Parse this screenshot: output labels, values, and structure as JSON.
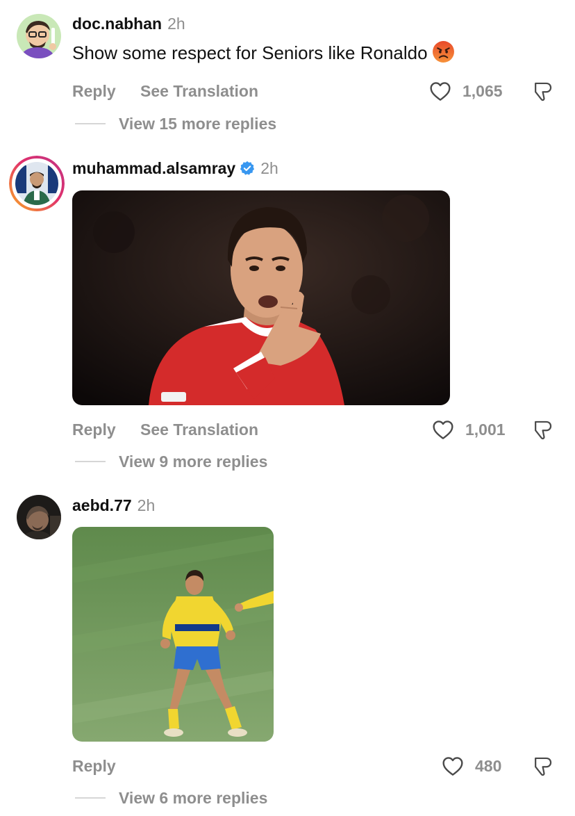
{
  "comments": [
    {
      "username": "doc.nabhan",
      "time": "2h",
      "text": "Show some respect for Seniors  like Ronaldo",
      "emoji": "angry-face",
      "actions": {
        "reply": "Reply",
        "translate": "See Translation"
      },
      "likes": "1,065",
      "view_replies": "View 15 more replies"
    },
    {
      "username": "muhammad.alsamray",
      "verified": true,
      "time": "2h",
      "media": "gif-ronaldo-red-jersey",
      "actions": {
        "reply": "Reply",
        "translate": "See Translation"
      },
      "likes": "1,001",
      "view_replies": "View 9 more replies"
    },
    {
      "username": "aebd.77",
      "time": "2h",
      "media": "gif-ronaldo-yellow-kit",
      "actions": {
        "reply": "Reply"
      },
      "likes": "480",
      "view_replies": "View 6 more replies"
    }
  ],
  "colors": {
    "text": "#111111",
    "muted": "#8e8e8e",
    "verified": "#3897f0",
    "story_ring_start": "#f9a825",
    "story_ring_end": "#c13584"
  }
}
